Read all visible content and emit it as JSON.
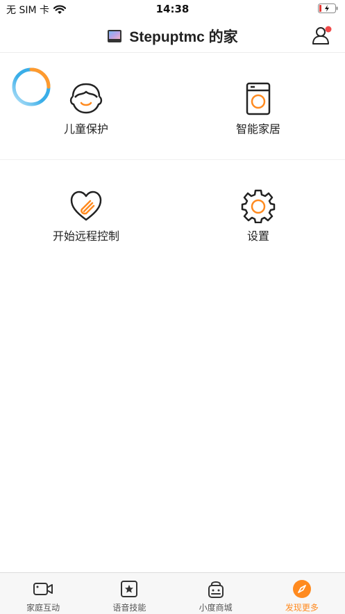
{
  "status_bar": {
    "carrier": "无 SIM 卡",
    "time": "14:38"
  },
  "header": {
    "title": "Stepuptmc 的家"
  },
  "features": [
    {
      "label": "儿童保护",
      "icon": "child-face-icon"
    },
    {
      "label": "智能家居",
      "icon": "washing-machine-icon"
    },
    {
      "label": "开始远程控制",
      "icon": "heart-hand-icon"
    },
    {
      "label": "设置",
      "icon": "gear-icon"
    }
  ],
  "tabs": [
    {
      "label": "家庭互动",
      "icon": "video-camera-icon",
      "active": false
    },
    {
      "label": "语音技能",
      "icon": "star-box-icon",
      "active": false
    },
    {
      "label": "小度商城",
      "icon": "shopping-bag-icon",
      "active": false
    },
    {
      "label": "发现更多",
      "icon": "compass-icon",
      "active": true
    }
  ],
  "colors": {
    "accent": "#ff8a1f",
    "notification_dot": "#f04a4a",
    "ring_blue": "#3aaee8",
    "ring_orange": "#ff9a2e"
  }
}
